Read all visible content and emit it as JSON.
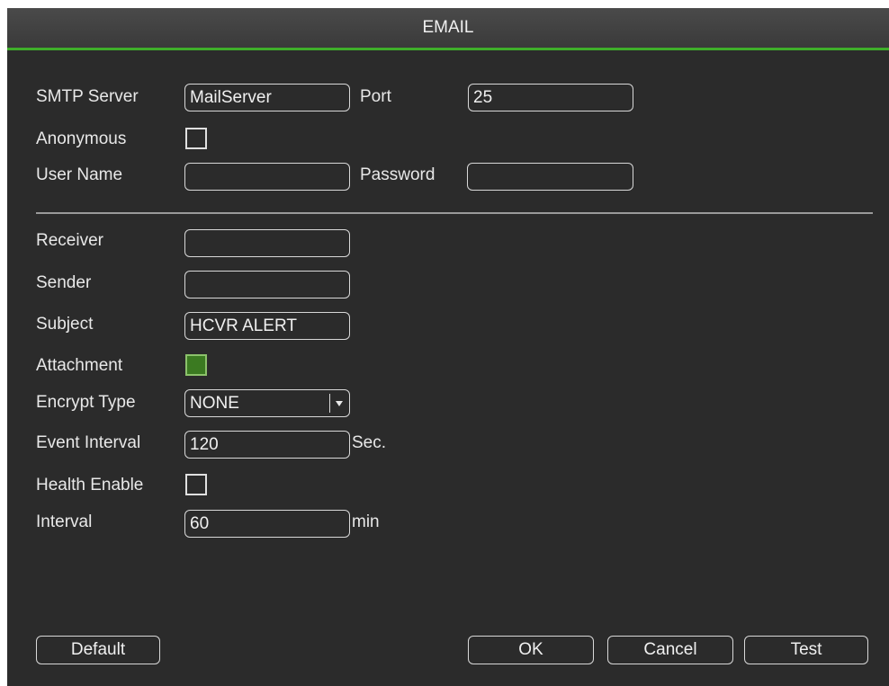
{
  "window": {
    "title": "EMAIL"
  },
  "form": {
    "smtp_server_label": "SMTP Server",
    "smtp_server_value": "MailServer",
    "port_label": "Port",
    "port_value": "25",
    "anonymous_label": "Anonymous",
    "anonymous_checked": false,
    "username_label": "User Name",
    "username_value": "",
    "password_label": "Password",
    "password_value": "",
    "receiver_label": "Receiver",
    "receiver_value": "",
    "sender_label": "Sender",
    "sender_value": "",
    "subject_label": "Subject",
    "subject_value": "HCVR ALERT",
    "attachment_label": "Attachment",
    "attachment_checked": true,
    "encrypt_label": "Encrypt Type",
    "encrypt_value": "NONE",
    "event_interval_label": "Event Interval",
    "event_interval_value": "120",
    "event_interval_unit": "Sec.",
    "health_enable_label": "Health Enable",
    "health_enable_checked": false,
    "interval_label": "Interval",
    "interval_value": "60",
    "interval_unit": "min"
  },
  "buttons": {
    "default_label": "Default",
    "ok_label": "OK",
    "cancel_label": "Cancel",
    "test_label": "Test"
  },
  "colors": {
    "accent": "#3fae2a",
    "background": "#2b2b2b",
    "checked_fill": "#3b7a21"
  }
}
